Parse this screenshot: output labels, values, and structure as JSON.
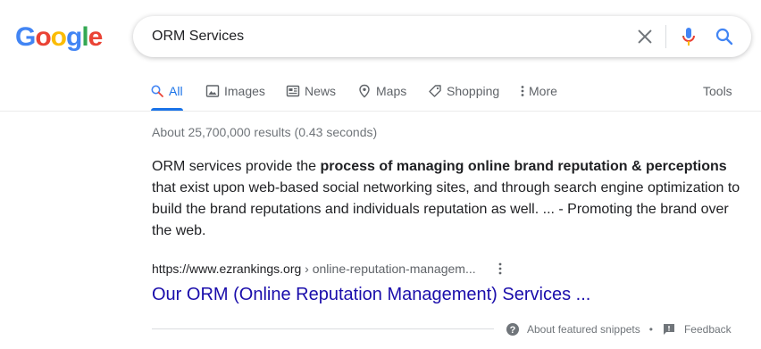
{
  "logo": {
    "letters": [
      "G",
      "o",
      "o",
      "g",
      "l",
      "e"
    ],
    "colors": [
      "#4285f4",
      "#ea4335",
      "#fbbc05",
      "#4285f4",
      "#34a853",
      "#ea4335"
    ]
  },
  "search": {
    "query": "ORM Services"
  },
  "tabs": [
    {
      "label": "All",
      "icon": "search-icon",
      "active": true
    },
    {
      "label": "Images",
      "icon": "image-icon"
    },
    {
      "label": "News",
      "icon": "news-icon"
    },
    {
      "label": "Maps",
      "icon": "map-pin-icon"
    },
    {
      "label": "Shopping",
      "icon": "tag-icon"
    },
    {
      "label": "More",
      "icon": "more-vert-icon"
    }
  ],
  "tools_label": "Tools",
  "stats": "About 25,700,000 results (0.43 seconds)",
  "snippet": {
    "pre": "ORM services provide the ",
    "bold": "process of managing online brand reputation & perceptions",
    "post": " that exist upon web-based social networking sites, and through search engine optimization to build the brand reputations and individuals reputation as well. ... - Promoting the brand over the web."
  },
  "result": {
    "domain": "https://www.ezrankings.org",
    "path": " › online-reputation-managem...",
    "title": "Our ORM (Online Reputation Management) Services ..."
  },
  "footer": {
    "about_label": "About featured snippets",
    "separator": "•",
    "feedback_label": "Feedback"
  },
  "colors": {
    "accent": "#1a73e8",
    "link": "#1a0dab",
    "muted": "#5f6368"
  }
}
